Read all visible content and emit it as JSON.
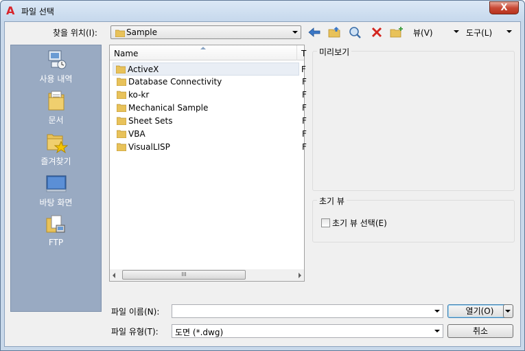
{
  "window": {
    "title": "파일 선택",
    "close_glyph": "X",
    "app_icon_glyph": "A"
  },
  "toolbar": {
    "look_in_label": "찾을 위치(I):",
    "look_in_value": "Sample",
    "view_menu": "뷰(V)",
    "tools_menu": "도구(L)"
  },
  "places": [
    {
      "label": "사용 내역",
      "icon": "history-icon"
    },
    {
      "label": "문서",
      "icon": "documents-icon"
    },
    {
      "label": "즐겨찾기",
      "icon": "favorites-icon"
    },
    {
      "label": "바탕 화면",
      "icon": "desktop-icon"
    },
    {
      "label": "FTP",
      "icon": "ftp-icon"
    }
  ],
  "file_list": {
    "column_name": "Name",
    "column_type": "T",
    "scroll_grip": "III",
    "items": [
      {
        "name": "ActiveX",
        "type": "F",
        "selected": true
      },
      {
        "name": "Database Connectivity",
        "type": "F"
      },
      {
        "name": "ko-kr",
        "type": "F"
      },
      {
        "name": "Mechanical Sample",
        "type": "F"
      },
      {
        "name": "Sheet Sets",
        "type": "F"
      },
      {
        "name": "VBA",
        "type": "F"
      },
      {
        "name": "VisualLISP",
        "type": "F"
      }
    ]
  },
  "preview": {
    "title": "미리보기"
  },
  "initial_view": {
    "title": "초기 뷰",
    "checkbox_label": "초기 뷰 선택(E)",
    "checked": false
  },
  "bottom": {
    "filename_label": "파일 이름(N):",
    "filename_value": "",
    "filetype_label": "파일 유형(T):",
    "filetype_value": "도면 (*.dwg)",
    "open_button": "열기(O)",
    "cancel_button": "취소"
  },
  "colors": {
    "accent": "#d8232a",
    "places_bg": "#99aac2",
    "folder": "#e8c25a"
  }
}
